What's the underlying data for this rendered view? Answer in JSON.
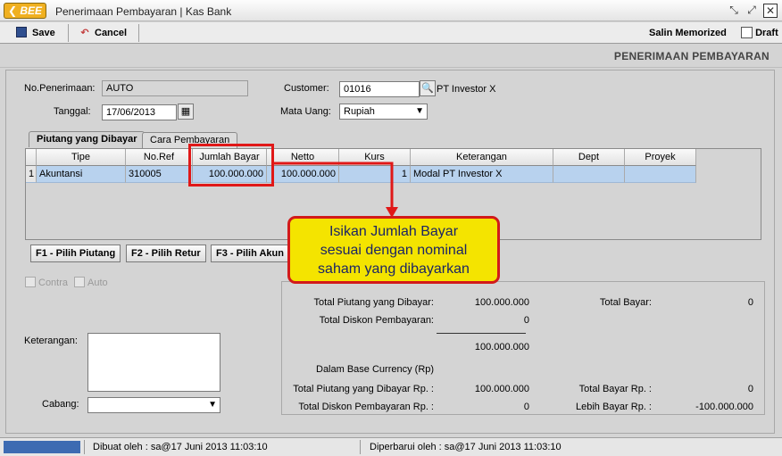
{
  "window": {
    "logo": "BEE",
    "title": "Penerimaan Pembayaran | Kas Bank"
  },
  "toolbar": {
    "save": "Save",
    "cancel": "Cancel",
    "salin_memorized": "Salin Memorized",
    "draft": "Draft"
  },
  "form_title": "PENERIMAAN PEMBAYARAN",
  "fields": {
    "no_penerimaan_label": "No.Penerimaan:",
    "no_penerimaan": "AUTO",
    "tanggal_label": "Tanggal:",
    "tanggal": "17/06/2013",
    "customer_label": "Customer:",
    "customer_code": "01016",
    "customer_name": "PT Investor X",
    "mata_uang_label": "Mata Uang:",
    "mata_uang": "Rupiah"
  },
  "tabs": [
    "Piutang yang Dibayar",
    "Cara Pembayaran"
  ],
  "grid": {
    "headers": [
      "Tipe",
      "No.Ref",
      "Jumlah Bayar",
      "Netto",
      "Kurs",
      "Keterangan",
      "Dept",
      "Proyek"
    ],
    "rows": [
      {
        "no": "1",
        "tipe": "Akuntansi",
        "noref": "310005",
        "jumlah_bayar": "100.000.000",
        "netto": "100.000.000",
        "kurs": "1",
        "keterangan": "Modal PT Investor X",
        "dept": "",
        "proyek": ""
      }
    ]
  },
  "buttons": {
    "f1": "F1 - Pilih Piutang",
    "f2": "F2 - Pilih Retur",
    "f3": "F3 - Pilih Akun"
  },
  "checks": {
    "contra": "Contra",
    "auto": "Auto"
  },
  "left": {
    "keterangan_label": "Keterangan:",
    "cabang_label": "Cabang:"
  },
  "summary": {
    "total_piutang_label": "Total Piutang yang Dibayar:",
    "total_piutang": "100.000.000",
    "total_diskon_label": "Total Diskon Pembayaran:",
    "total_diskon": "0",
    "subtotal": "100.000.000",
    "total_bayar_label": "Total Bayar:",
    "total_bayar": "0",
    "base_currency_label": "Dalam Base Currency (Rp)",
    "total_piutang_rp_label": "Total Piutang yang Dibayar Rp. :",
    "total_piutang_rp": "100.000.000",
    "total_diskon_rp_label": "Total Diskon Pembayaran Rp. :",
    "total_diskon_rp": "0",
    "total_bayar_rp_label": "Total Bayar Rp. :",
    "total_bayar_rp": "0",
    "lebih_bayar_rp_label": "Lebih Bayar Rp. :",
    "lebih_bayar_rp": "-100.000.000"
  },
  "callout": {
    "line1": "Isikan Jumlah Bayar",
    "line2": "sesuai dengan nominal",
    "line3": "saham yang dibayarkan"
  },
  "status": {
    "dibuat": "Dibuat oleh : sa@17 Juni 2013  11:03:10",
    "diperbarui": "Diperbarui oleh : sa@17 Juni 2013  11:03:10"
  },
  "colors": {
    "accent_red": "#e01818",
    "callout_bg": "#f4e400",
    "selected_row": "#b8d2ee"
  }
}
